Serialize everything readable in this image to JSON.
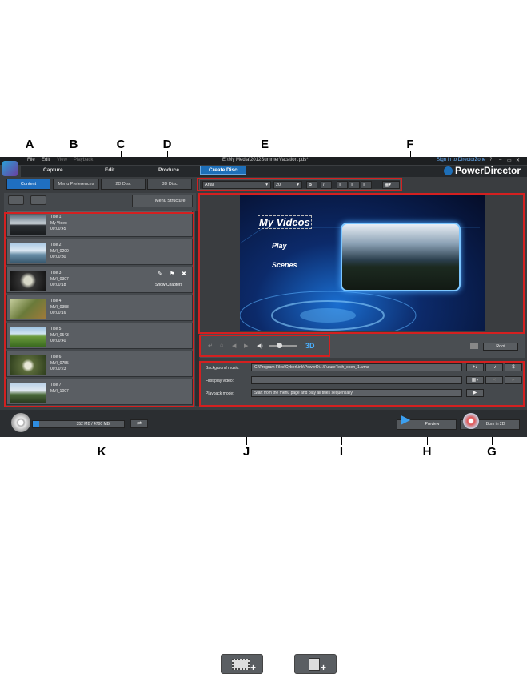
{
  "callouts": {
    "A": "A",
    "B": "B",
    "C": "C",
    "D": "D",
    "E": "E",
    "F": "F",
    "G": "G",
    "H": "H",
    "I": "I",
    "J": "J",
    "K": "K"
  },
  "window": {
    "menus": [
      "File",
      "Edit",
      "View",
      "Playback"
    ],
    "path": "E:\\My Media\\2012SummerVacation.pds*",
    "sign_in": "Sign in to DirectorZone",
    "help": "?",
    "ctrls": [
      "–",
      "▭",
      "✕"
    ]
  },
  "modes": {
    "capture": "Capture",
    "edit": "Edit",
    "produce": "Produce",
    "create_disc": "Create Disc"
  },
  "brand": "PowerDirector",
  "tabs": {
    "content": "Content",
    "menu_prefs": "Menu Preferences",
    "disc2d": "2D Disc",
    "disc3d": "3D Disc"
  },
  "format": {
    "font": "Arial",
    "size": "20",
    "bold": "B",
    "italic": "I"
  },
  "left": {
    "menu_structure": "Menu Structure",
    "titles": [
      {
        "name": "Title 1",
        "clip": "My Video",
        "dur": "00:00:45"
      },
      {
        "name": "Title 2",
        "clip": "MVI_0200",
        "dur": "00:00:30"
      },
      {
        "name": "Title 3",
        "clip": "MVI_0307",
        "dur": "00:00:18",
        "link": "Show Chapters"
      },
      {
        "name": "Title 4",
        "clip": "MVI_0358",
        "dur": "00:00:16"
      },
      {
        "name": "Title 5",
        "clip": "MVI_0543",
        "dur": "00:00:40"
      },
      {
        "name": "Title 6",
        "clip": "MVI_0755",
        "dur": "00:00:23"
      },
      {
        "name": "Title 7",
        "clip": "MVI_1007",
        "dur": ""
      }
    ]
  },
  "menu_canvas": {
    "title": "My Videos",
    "play": "Play",
    "scenes": "Scenes"
  },
  "controls": {
    "mode3d": "3D",
    "root": "Root"
  },
  "settings": {
    "bg_music_label": "Background music:",
    "bg_music_value": "C:\\Program Files\\CyberLink\\PowerDi...\\FutureTech_open_1.wma",
    "first_play_label": "First play video:",
    "first_play_value": "",
    "playback_label": "Playback mode:",
    "playback_value": "Start from the menu page and play all titles sequentially"
  },
  "bottom": {
    "capacity": "352 MB / 4700 MB",
    "preview": "Preview",
    "burn": "Burn in 2D"
  },
  "colors": {
    "accent": "#1e6fb8",
    "callout_box": "#d42020"
  }
}
